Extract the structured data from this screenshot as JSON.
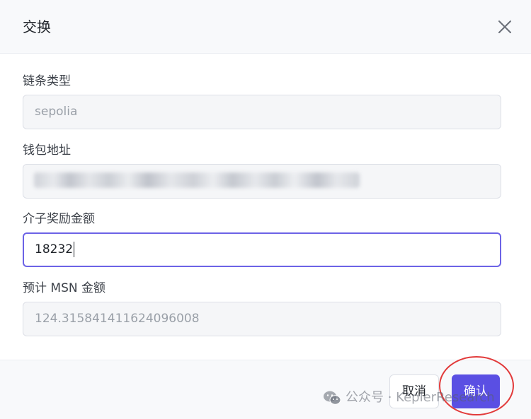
{
  "dialog": {
    "title": "交换",
    "close_icon": "close-icon"
  },
  "fields": {
    "chain_type": {
      "label": "链条类型",
      "value": "sepolia"
    },
    "wallet_address": {
      "label": "钱包地址"
    },
    "reward_amount": {
      "label": "介子奖励金额",
      "value": "18232"
    },
    "estimated_msn": {
      "label": "预计 MSN 金额",
      "value": "124.315841411624096008"
    }
  },
  "footer": {
    "cancel_label": "取消",
    "confirm_label": "确认"
  },
  "watermark": {
    "text": "公众号 · KeplerResearch",
    "icon": "wechat-icon"
  },
  "colors": {
    "primary": "#5a4fe3",
    "focus_border": "#6c63e6",
    "highlight": "#e23b3b"
  }
}
